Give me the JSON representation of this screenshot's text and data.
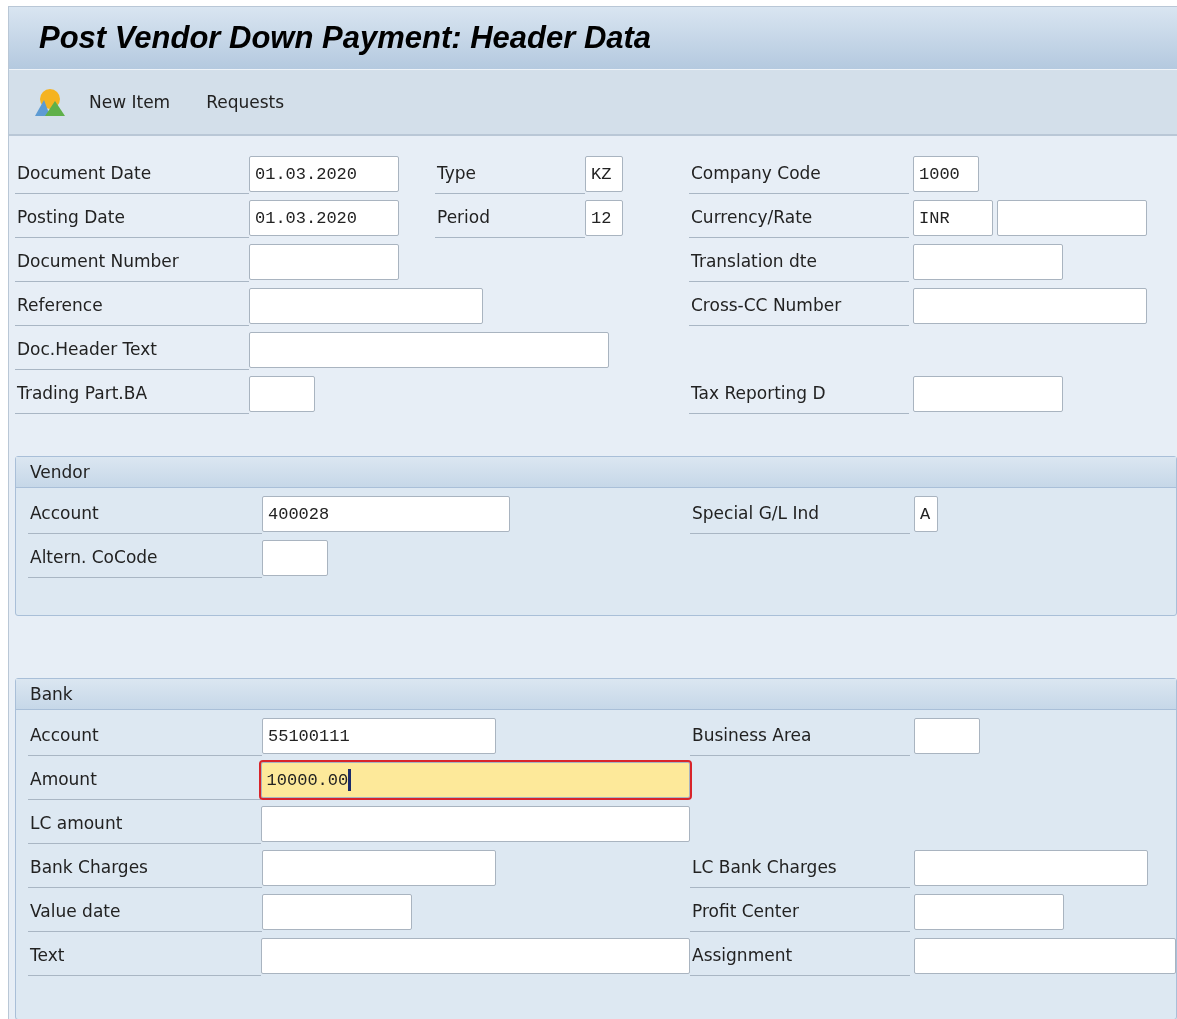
{
  "window": {
    "title": "Post Vendor Down Payment: Header Data"
  },
  "toolbar": {
    "items": [
      {
        "label": "New Item"
      },
      {
        "label": "Requests"
      }
    ]
  },
  "header": {
    "rows": [
      {
        "left": {
          "label": "Document Date",
          "fields": [
            {
              "value": "01.03.2020",
              "focused": false
            }
          ]
        },
        "middle": {
          "label": "Type",
          "fields": [
            {
              "value": "KZ",
              "focused": false
            }
          ]
        },
        "right": {
          "label": "Company Code",
          "fields": [
            {
              "value": "1000",
              "focused": false
            }
          ]
        }
      },
      {
        "left": {
          "label": "Posting Date",
          "fields": [
            {
              "value": "01.03.2020",
              "focused": false
            }
          ]
        },
        "middle": {
          "label": "Period",
          "fields": [
            {
              "value": "12",
              "focused": false
            }
          ]
        },
        "right": {
          "label": "Currency/Rate",
          "fields": [
            {
              "value": "INR",
              "focused": false
            },
            {
              "focused": false
            }
          ]
        }
      },
      {
        "left": {
          "label": "Document Number",
          "fields": [
            {
              "focused": false
            }
          ]
        },
        "right": {
          "label": "Translation dte",
          "fields": [
            {
              "focused": false
            }
          ]
        }
      },
      {
        "left": {
          "label": "Reference",
          "fields": [
            {
              "focused": false
            }
          ]
        },
        "right": {
          "label": "Cross-CC Number",
          "fields": [
            {
              "focused": false
            }
          ]
        }
      },
      {
        "left": {
          "label": "Doc.Header Text",
          "fields": [
            {
              "focused": false
            }
          ]
        }
      },
      {
        "left": {
          "label": "Trading Part.BA",
          "fields": [
            {
              "focused": false
            }
          ]
        },
        "right": {
          "label": "Tax Reporting D",
          "fields": [
            {
              "focused": false
            }
          ]
        }
      }
    ]
  },
  "sections": [
    {
      "title": "Vendor",
      "rows": [
        {
          "left": {
            "label": "Account",
            "fields": [
              {
                "value": "400028",
                "focused": false
              }
            ]
          },
          "right": {
            "label": "Special G/L Ind",
            "fields": [
              {
                "value": "A",
                "focused": false
              }
            ]
          }
        },
        {
          "left": {
            "label": "Altern. CoCode",
            "fields": [
              {
                "focused": false
              }
            ]
          }
        }
      ]
    },
    {
      "title": "Bank",
      "rows": [
        {
          "left": {
            "label": "Account",
            "fields": [
              {
                "value": "55100111",
                "focused": false
              }
            ]
          },
          "right": {
            "label": "Business Area",
            "fields": [
              {
                "focused": false
              }
            ]
          }
        },
        {
          "left": {
            "label": "Amount",
            "fields": [
              {
                "value": "10000.00",
                "focused": true
              }
            ]
          }
        },
        {
          "left": {
            "label": "LC amount",
            "fields": [
              {
                "focused": false
              }
            ]
          }
        },
        {
          "left": {
            "label": "Bank Charges",
            "fields": [
              {
                "focused": false
              }
            ]
          },
          "right": {
            "label": "LC Bank Charges",
            "fields": [
              {
                "focused": false
              }
            ]
          }
        },
        {
          "left": {
            "label": "Value date",
            "fields": [
              {
                "focused": false
              }
            ]
          },
          "right": {
            "label": "Profit Center",
            "fields": [
              {
                "focused": false
              }
            ]
          }
        },
        {
          "left": {
            "label": "Text",
            "fields": [
              {
                "focused": false
              }
            ]
          },
          "right": {
            "label": "Assignment",
            "fields": [
              {
                "focused": false
              }
            ]
          }
        }
      ]
    }
  ]
}
